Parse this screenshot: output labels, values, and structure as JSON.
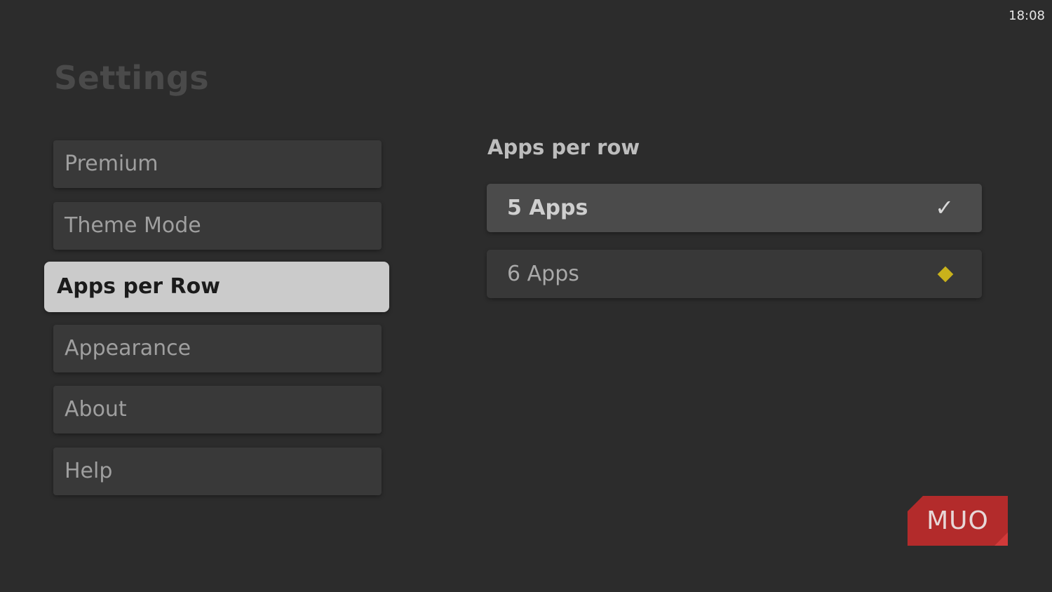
{
  "status_bar": {
    "time": "18:08"
  },
  "page": {
    "title": "Settings"
  },
  "menu": {
    "items": [
      {
        "label": "Premium",
        "selected": false
      },
      {
        "label": "Theme Mode",
        "selected": false
      },
      {
        "label": "Apps per Row",
        "selected": true
      },
      {
        "label": "Appearance",
        "selected": false
      },
      {
        "label": "About",
        "selected": false
      },
      {
        "label": "Help",
        "selected": false
      }
    ]
  },
  "detail": {
    "heading": "Apps per row",
    "options": [
      {
        "label": "5 Apps",
        "state": "checked",
        "icon": "check-icon"
      },
      {
        "label": "6 Apps",
        "state": "focused",
        "icon": "diamond-icon"
      }
    ]
  },
  "watermark": {
    "text": "MUO",
    "color": "#b32b2b"
  },
  "colors": {
    "background": "#2c2c2c",
    "selected_item": "#cbcbcb",
    "focus_indicator": "#c9b21b"
  }
}
